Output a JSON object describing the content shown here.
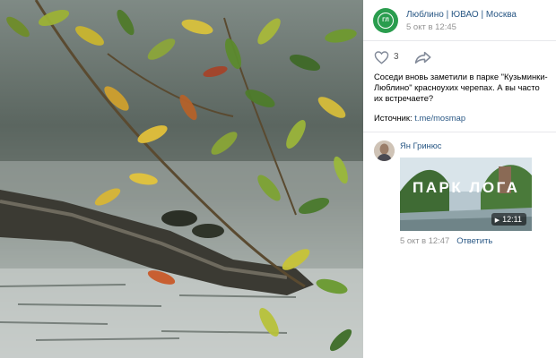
{
  "post": {
    "group_name": "Люблино | ЮВАО | Москва",
    "avatar_text": "ГЛ",
    "date": "5 окт в 12:45",
    "likes": "3",
    "text": "Соседи вновь заметили в парке \"Кузьминки-Люблино\" красноухих черепах. А вы часто их встречаете?",
    "source_label": "Источник:",
    "source_link": "t.me/mosmap"
  },
  "comment": {
    "author": "Ян Гринюс",
    "video_title": "ПАРК ЛОГА",
    "video_duration": "12:11",
    "date": "5 окт в 12:47",
    "reply_label": "Ответить"
  },
  "colors": {
    "link": "#2a5885",
    "muted": "#939393",
    "group_avatar": "#2a9d4e"
  }
}
